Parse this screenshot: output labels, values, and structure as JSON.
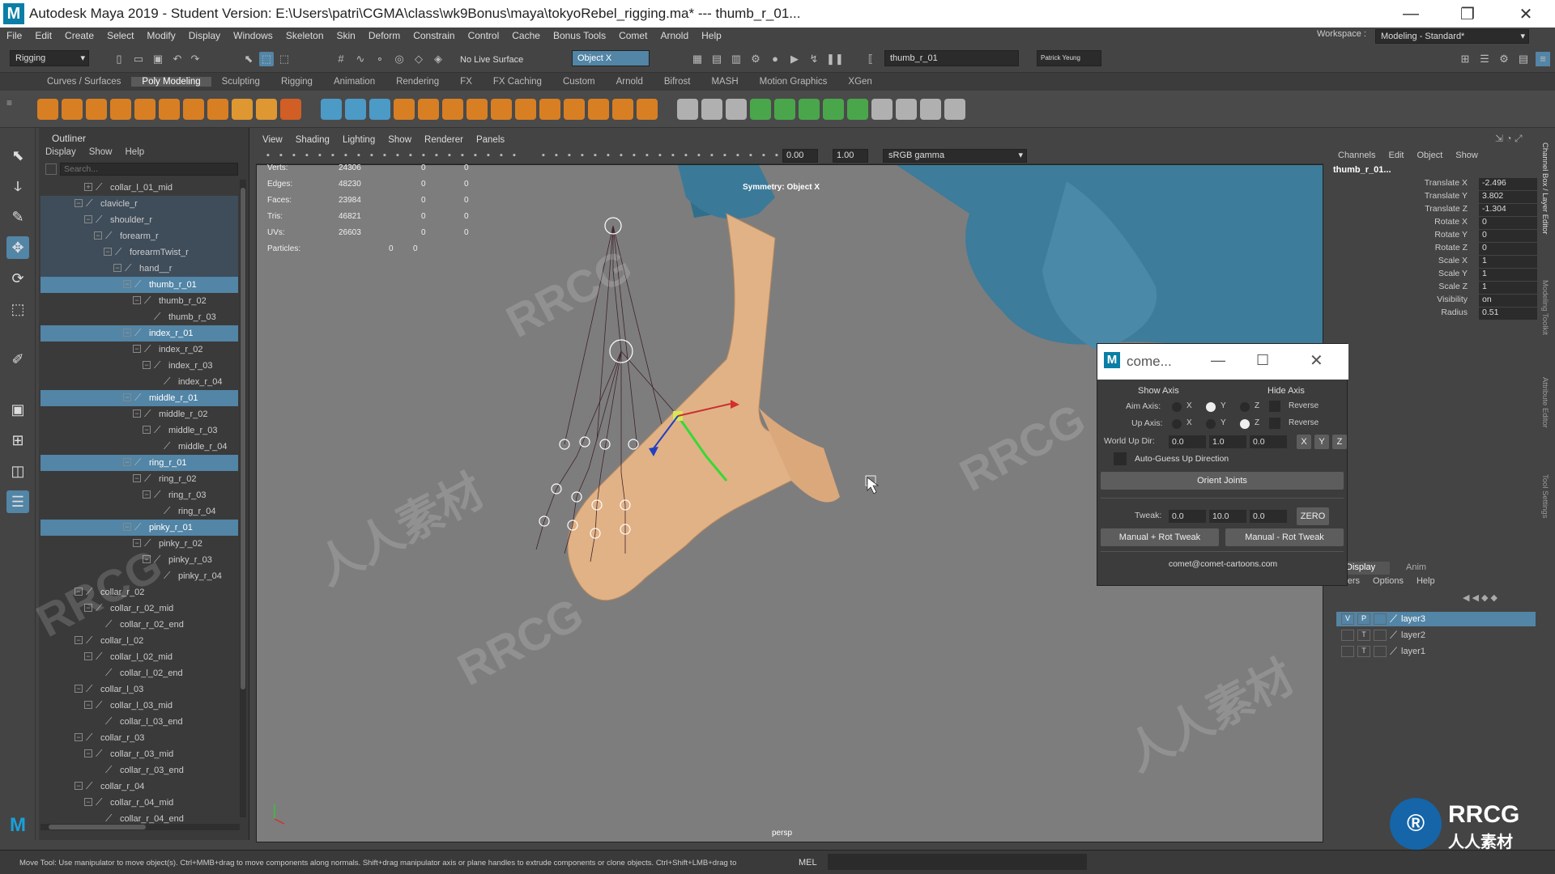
{
  "window": {
    "title": "Autodesk Maya 2019 - Student Version: E:\\Users\\patri\\CGMA\\class\\wk9Bonus\\maya\\tokyoRebel_rigging.ma*   ---   thumb_r_01...",
    "logo": "M",
    "minimize": "—",
    "maximize": "❐",
    "close": "✕"
  },
  "menubar": [
    "File",
    "Edit",
    "Create",
    "Select",
    "Modify",
    "Display",
    "Windows",
    "Skeleton",
    "Skin",
    "Deform",
    "Constrain",
    "Control",
    "Cache",
    "Bonus Tools",
    "Comet",
    "Arnold",
    "Help"
  ],
  "workspace": {
    "label": "Workspace :",
    "value": "Modeling - Standard*"
  },
  "statusline": {
    "menuset": "Rigging",
    "live_surface": "No Live Surface",
    "symmetry": "Object X",
    "selected_name": "thumb_r_01",
    "user": "Patrick Yeung"
  },
  "shelf_tabs": [
    {
      "label": "Curves / Surfaces",
      "active": false
    },
    {
      "label": "Poly Modeling",
      "active": true
    },
    {
      "label": "Sculpting",
      "active": false
    },
    {
      "label": "Rigging",
      "active": false
    },
    {
      "label": "Animation",
      "active": false
    },
    {
      "label": "Rendering",
      "active": false
    },
    {
      "label": "FX",
      "active": false
    },
    {
      "label": "FX Caching",
      "active": false
    },
    {
      "label": "Custom",
      "active": false
    },
    {
      "label": "Arnold",
      "active": false
    },
    {
      "label": "Bifrost",
      "active": false
    },
    {
      "label": "MASH",
      "active": false
    },
    {
      "label": "Motion Graphics",
      "active": false
    },
    {
      "label": "XGen",
      "active": false
    }
  ],
  "shelf_colors": [
    "#e8851f",
    "#e8851f",
    "#e8851f",
    "#e8851f",
    "#e8851f",
    "#e8851f",
    "#e8851f",
    "#e8851f",
    "#f0a030",
    "#f0a030",
    "#e06020",
    "#4da3d4",
    "#4da3d4",
    "#4da3d4",
    "#e8851f",
    "#e8851f",
    "#e8851f",
    "#e8851f",
    "#e8851f",
    "#e8851f",
    "#e8851f",
    "#e8851f",
    "#e8851f",
    "#e8851f",
    "#e8851f",
    "#bbbbbb",
    "#bbbbbb",
    "#bbbbbb",
    "#4ab04a",
    "#4ab04a",
    "#4ab04a",
    "#4ab04a",
    "#4ab04a",
    "#bbbbbb",
    "#bbbbbb",
    "#bbbbbb",
    "#bbbbbb"
  ],
  "outliner": {
    "title": "Outliner",
    "menu": [
      "Display",
      "Show",
      "Help"
    ],
    "search_placeholder": "Search...",
    "rows": [
      {
        "label": "collar_l_01_mid",
        "depth": 2,
        "exp": "+",
        "sel": false,
        "hl": false
      },
      {
        "label": "clavicle_r",
        "depth": 1,
        "exp": "−",
        "sel": false,
        "hl": true
      },
      {
        "label": "shoulder_r",
        "depth": 2,
        "exp": "−",
        "sel": false,
        "hl": true
      },
      {
        "label": "forearm_r",
        "depth": 3,
        "exp": "−",
        "sel": false,
        "hl": true
      },
      {
        "label": "forearmTwist_r",
        "depth": 4,
        "exp": "−",
        "sel": false,
        "hl": true
      },
      {
        "label": "hand__r",
        "depth": 5,
        "exp": "−",
        "sel": false,
        "hl": true
      },
      {
        "label": "thumb_r_01",
        "depth": 6,
        "exp": "−",
        "sel": true,
        "hl": false
      },
      {
        "label": "thumb_r_02",
        "depth": 7,
        "exp": "−",
        "sel": false,
        "hl": false
      },
      {
        "label": "thumb_r_03",
        "depth": 8,
        "exp": "",
        "sel": false,
        "hl": false
      },
      {
        "label": "index_r_01",
        "depth": 6,
        "exp": "−",
        "sel": true,
        "hl": false
      },
      {
        "label": "index_r_02",
        "depth": 7,
        "exp": "−",
        "sel": false,
        "hl": false
      },
      {
        "label": "index_r_03",
        "depth": 8,
        "exp": "−",
        "sel": false,
        "hl": false
      },
      {
        "label": "index_r_04",
        "depth": 9,
        "exp": "",
        "sel": false,
        "hl": false
      },
      {
        "label": "middle_r_01",
        "depth": 6,
        "exp": "−",
        "sel": true,
        "hl": false
      },
      {
        "label": "middle_r_02",
        "depth": 7,
        "exp": "−",
        "sel": false,
        "hl": false
      },
      {
        "label": "middle_r_03",
        "depth": 8,
        "exp": "−",
        "sel": false,
        "hl": false
      },
      {
        "label": "middle_r_04",
        "depth": 9,
        "exp": "",
        "sel": false,
        "hl": false
      },
      {
        "label": "ring_r_01",
        "depth": 6,
        "exp": "−",
        "sel": true,
        "hl": false
      },
      {
        "label": "ring_r_02",
        "depth": 7,
        "exp": "−",
        "sel": false,
        "hl": false
      },
      {
        "label": "ring_r_03",
        "depth": 8,
        "exp": "−",
        "sel": false,
        "hl": false
      },
      {
        "label": "ring_r_04",
        "depth": 9,
        "exp": "",
        "sel": false,
        "hl": false
      },
      {
        "label": "pinky_r_01",
        "depth": 6,
        "exp": "−",
        "sel": true,
        "hl": false
      },
      {
        "label": "pinky_r_02",
        "depth": 7,
        "exp": "−",
        "sel": false,
        "hl": false
      },
      {
        "label": "pinky_r_03",
        "depth": 8,
        "exp": "−",
        "sel": false,
        "hl": false
      },
      {
        "label": "pinky_r_04",
        "depth": 9,
        "exp": "",
        "sel": false,
        "hl": false
      },
      {
        "label": "collar_r_02",
        "depth": 1,
        "exp": "−",
        "sel": false,
        "hl": false
      },
      {
        "label": "collar_r_02_mid",
        "depth": 2,
        "exp": "−",
        "sel": false,
        "hl": false
      },
      {
        "label": "collar_r_02_end",
        "depth": 3,
        "exp": "",
        "sel": false,
        "hl": false
      },
      {
        "label": "collar_l_02",
        "depth": 1,
        "exp": "−",
        "sel": false,
        "hl": false
      },
      {
        "label": "collar_l_02_mid",
        "depth": 2,
        "exp": "−",
        "sel": false,
        "hl": false
      },
      {
        "label": "collar_l_02_end",
        "depth": 3,
        "exp": "",
        "sel": false,
        "hl": false
      },
      {
        "label": "collar_l_03",
        "depth": 1,
        "exp": "−",
        "sel": false,
        "hl": false
      },
      {
        "label": "collar_l_03_mid",
        "depth": 2,
        "exp": "−",
        "sel": false,
        "hl": false
      },
      {
        "label": "collar_l_03_end",
        "depth": 3,
        "exp": "",
        "sel": false,
        "hl": false
      },
      {
        "label": "collar_r_03",
        "depth": 1,
        "exp": "−",
        "sel": false,
        "hl": false
      },
      {
        "label": "collar_r_03_mid",
        "depth": 2,
        "exp": "−",
        "sel": false,
        "hl": false
      },
      {
        "label": "collar_r_03_end",
        "depth": 3,
        "exp": "",
        "sel": false,
        "hl": false
      },
      {
        "label": "collar_r_04",
        "depth": 1,
        "exp": "−",
        "sel": false,
        "hl": false
      },
      {
        "label": "collar_r_04_mid",
        "depth": 2,
        "exp": "−",
        "sel": false,
        "hl": false
      },
      {
        "label": "collar_r_04_end",
        "depth": 3,
        "exp": "",
        "sel": false,
        "hl": false
      }
    ]
  },
  "viewport": {
    "menu": [
      "View",
      "Shading",
      "Lighting",
      "Show",
      "Renderer",
      "Panels"
    ],
    "exposure": "0.00",
    "gamma": "1.00",
    "colorspace": "sRGB gamma",
    "symmetry_label": "Symmetry: Object X",
    "camera": "persp",
    "hud": [
      {
        "k": "Verts:",
        "v": "24306",
        "a": "0",
        "b": "0"
      },
      {
        "k": "Edges:",
        "v": "48230",
        "a": "0",
        "b": "0"
      },
      {
        "k": "Faces:",
        "v": "23984",
        "a": "0",
        "b": "0"
      },
      {
        "k": "Tris:",
        "v": "46821",
        "a": "0",
        "b": "0"
      },
      {
        "k": "UVs:",
        "v": "26603",
        "a": "0",
        "b": "0"
      },
      {
        "k": "Particles:",
        "v": "",
        "a": "0",
        "b": "0"
      }
    ]
  },
  "channelbox": {
    "menu": [
      "Channels",
      "Edit",
      "Object",
      "Show"
    ],
    "node": "thumb_r_01...",
    "attrs": [
      {
        "k": "Translate X",
        "v": "-2.496"
      },
      {
        "k": "Translate Y",
        "v": "3.802"
      },
      {
        "k": "Translate Z",
        "v": "-1.304"
      },
      {
        "k": "Rotate X",
        "v": "0"
      },
      {
        "k": "Rotate Y",
        "v": "0"
      },
      {
        "k": "Rotate Z",
        "v": "0"
      },
      {
        "k": "Scale X",
        "v": "1"
      },
      {
        "k": "Scale Y",
        "v": "1"
      },
      {
        "k": "Scale Z",
        "v": "1"
      },
      {
        "k": "Visibility",
        "v": "on"
      },
      {
        "k": "Radius",
        "v": "0.51"
      }
    ],
    "side_tabs": [
      "Channel Box / Layer Editor",
      "Modeling Toolkit",
      "Attribute Editor",
      "Tool Settings"
    ]
  },
  "layers": {
    "tabs": [
      "Display",
      "Anim"
    ],
    "menu": [
      "Layers",
      "Options",
      "Help"
    ],
    "rows": [
      {
        "v": "V",
        "p": "P",
        "name": "layer3",
        "sel": true
      },
      {
        "v": "",
        "p": "T",
        "name": "layer2",
        "sel": false
      },
      {
        "v": "",
        "p": "T",
        "name": "layer1",
        "sel": false
      }
    ]
  },
  "comet": {
    "title": "come...",
    "show_axis": "Show Axis",
    "hide_axis": "Hide Axis",
    "aim_label": "Aim Axis:",
    "up_label": "Up Axis:",
    "x": "X",
    "y": "Y",
    "z": "Z",
    "reverse": "Reverse",
    "world_up_label": "World Up Dir:",
    "world_up": [
      "0.0",
      "1.0",
      "0.0"
    ],
    "auto_guess": "Auto-Guess Up Direction",
    "orient": "Orient Joints",
    "tweak_label": "Tweak:",
    "tweak": [
      "0.0",
      "10.0",
      "0.0"
    ],
    "zero": "ZERO",
    "manual_plus": "Manual + Rot Tweak",
    "manual_minus": "Manual - Rot Tweak",
    "email": "comet@comet-cartoons.com"
  },
  "helpline": {
    "text": "Move Tool: Use manipulator to move object(s). Ctrl+MMB+drag to move components along normals. Shift+drag manipulator axis or plane handles to extrude components or clone objects. Ctrl+Shift+LMB+drag to",
    "lang": "MEL"
  },
  "watermarks": [
    "RRCG",
    "人人素材"
  ],
  "badge": {
    "line1": "RRCG",
    "line2": "人人素材"
  }
}
